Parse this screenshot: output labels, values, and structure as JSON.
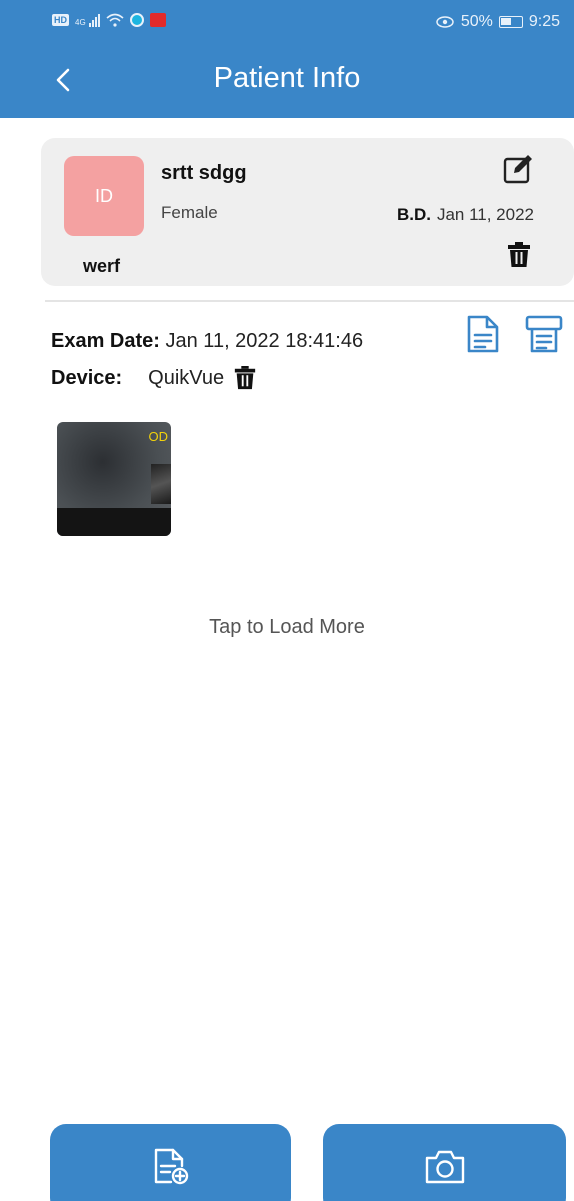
{
  "status_bar": {
    "left_icons": [
      "hd-icon",
      "signal-icon",
      "wifi-icon",
      "vpn-icon",
      "app-notification-icon"
    ],
    "network": "4G",
    "battery": "50%",
    "time": "9:25"
  },
  "header": {
    "title": "Patient Info"
  },
  "patient": {
    "avatar_text": "ID",
    "name": "srtt sdgg",
    "gender": "Female",
    "birth_date_label": "B.D.",
    "birth_date": "Jan 11, 2022",
    "id": "werf"
  },
  "exam": {
    "date_label": "Exam Date:",
    "date_value": "Jan 11, 2022 18:41:46",
    "device_label": "Device:",
    "device_value": "QuikVue",
    "image_tag": "OD"
  },
  "load_more": "Tap to Load More",
  "colors": {
    "primary": "#3a86c8",
    "avatar": "#f4a1a1",
    "card_bg": "#efefef",
    "tag_yellow": "#f2d20b"
  }
}
